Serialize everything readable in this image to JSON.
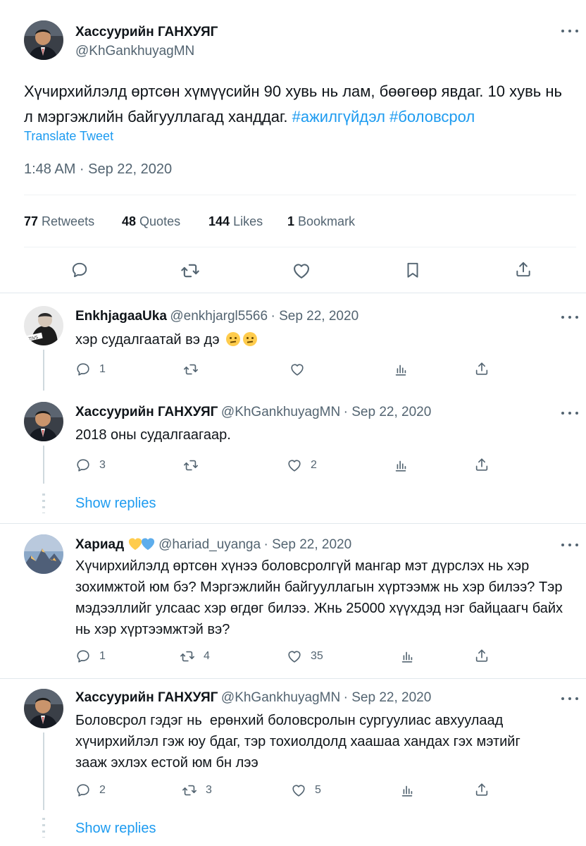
{
  "main_tweet": {
    "author_name": "Хассуурийн ГАНХУЯГ",
    "author_handle": "@KhGankhuyagMN",
    "text": "Хүчирхийлэлд өртсөн хүмүүсийн 90 хувь нь лам, бөөгөөр явдаг. 10 хувь нь л мэргэжлийн байгууллагад ханддаг.",
    "hashtags": [
      "#ажилгүйдэл",
      "#боловсрол"
    ],
    "translate_label": "Translate Tweet",
    "timestamp": "1:48 AM · Sep 22, 2020",
    "stats": {
      "retweets_count": "77",
      "retweets_label": "Retweets",
      "quotes_count": "48",
      "quotes_label": "Quotes",
      "likes_count": "144",
      "likes_label": "Likes",
      "bookmarks_count": "1",
      "bookmarks_label": "Bookmark"
    }
  },
  "replies": [
    {
      "author_name": "EnkhjagaaUka",
      "author_handle": "@enkhjargl5566",
      "date": "· Sep 22, 2020",
      "text": "хэр судалгаатай вэ дэ",
      "emojis": [
        "thinking-face",
        "thinking-face"
      ],
      "reply_count": "1",
      "retweet_count": "",
      "like_count": "",
      "view_count": ""
    },
    {
      "author_name": "Хассуурийн ГАНХУЯГ",
      "author_handle": "@KhGankhuyagMN",
      "date": "· Sep 22, 2020",
      "text": "2018 оны судалгаагаар.",
      "reply_count": "3",
      "retweet_count": "",
      "like_count": "2",
      "view_count": ""
    },
    {
      "author_name": "Хариад",
      "author_badges": [
        "yellow-heart",
        "blue-heart"
      ],
      "author_handle": "@hariad_uyanga",
      "date": "· Sep 22, 2020",
      "text": "Хүчирхийлэлд өртсөн хүнээ боловсролгүй мангар мэт дүрслэх нь хэр зохимжтой юм бэ? Мэргэжлийн байгууллагын хүртээмж нь хэр билээ? Тэр мэдээллийг улсаас хэр өгдөг билээ. Жнь 25000 хүүхдэд нэг байцаагч байх нь хэр хүртээмжтэй вэ?",
      "reply_count": "1",
      "retweet_count": "4",
      "like_count": "35",
      "view_count": ""
    },
    {
      "author_name": "Хассуурийн ГАНХУЯГ",
      "author_handle": "@KhGankhuyagMN",
      "date": "· Sep 22, 2020",
      "text": "Боловсрол гэдэг нь  ерөнхий боловсролын сургуулиас авхуулаад хүчирхийлэл гэж юу бдаг, тэр тохиолдолд хаашаа хандах гэх мэтийг зааж эхлэх естой юм бн лээ",
      "reply_count": "2",
      "retweet_count": "3",
      "like_count": "5",
      "view_count": ""
    }
  ],
  "show_replies_label": "Show replies",
  "colors": {
    "accent": "#1d9bf0",
    "secondary_text": "#536471",
    "border": "#eff3f4",
    "thread_line": "#cfd9de"
  },
  "icons": [
    "more-icon",
    "reply-icon",
    "retweet-icon",
    "like-icon",
    "bookmark-icon",
    "share-icon",
    "views-icon"
  ]
}
